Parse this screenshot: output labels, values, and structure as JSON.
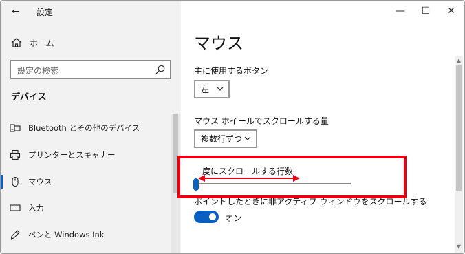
{
  "window": {
    "title": "設定",
    "controls": {
      "minimize": "—",
      "maximize": "☐",
      "close": "✕"
    }
  },
  "sidebar": {
    "back_glyph": "←",
    "home_label": "ホーム",
    "search_placeholder": "設定の検索",
    "section_title": "デバイス",
    "items": [
      {
        "label": "Bluetooth とその他のデバイス",
        "icon": "bluetooth-device-icon",
        "selected": false
      },
      {
        "label": "プリンターとスキャナー",
        "icon": "printer-icon",
        "selected": false
      },
      {
        "label": "マウス",
        "icon": "mouse-icon",
        "selected": true
      },
      {
        "label": "入力",
        "icon": "keyboard-icon",
        "selected": false
      },
      {
        "label": "ペンと Windows Ink",
        "icon": "pen-icon",
        "selected": false
      }
    ]
  },
  "main": {
    "page_title": "マウス",
    "primary_button": {
      "label": "主に使用するボタン",
      "value": "左"
    },
    "wheel_scroll": {
      "label": "マウス ホイールでスクロールする量",
      "value": "複数行ずつ"
    },
    "lines_to_scroll": {
      "label": "一度にスクロールする行数",
      "slider_fraction": 0.0
    },
    "inactive_scroll": {
      "label": "ポイントしたときに非アクティブ ウィンドウをスクロールする",
      "toggle_state": "オン",
      "on": true
    }
  },
  "colors": {
    "accent": "#0a60c2",
    "annotation": "#e60012",
    "sidebar_bg": "#f2f2f2"
  }
}
